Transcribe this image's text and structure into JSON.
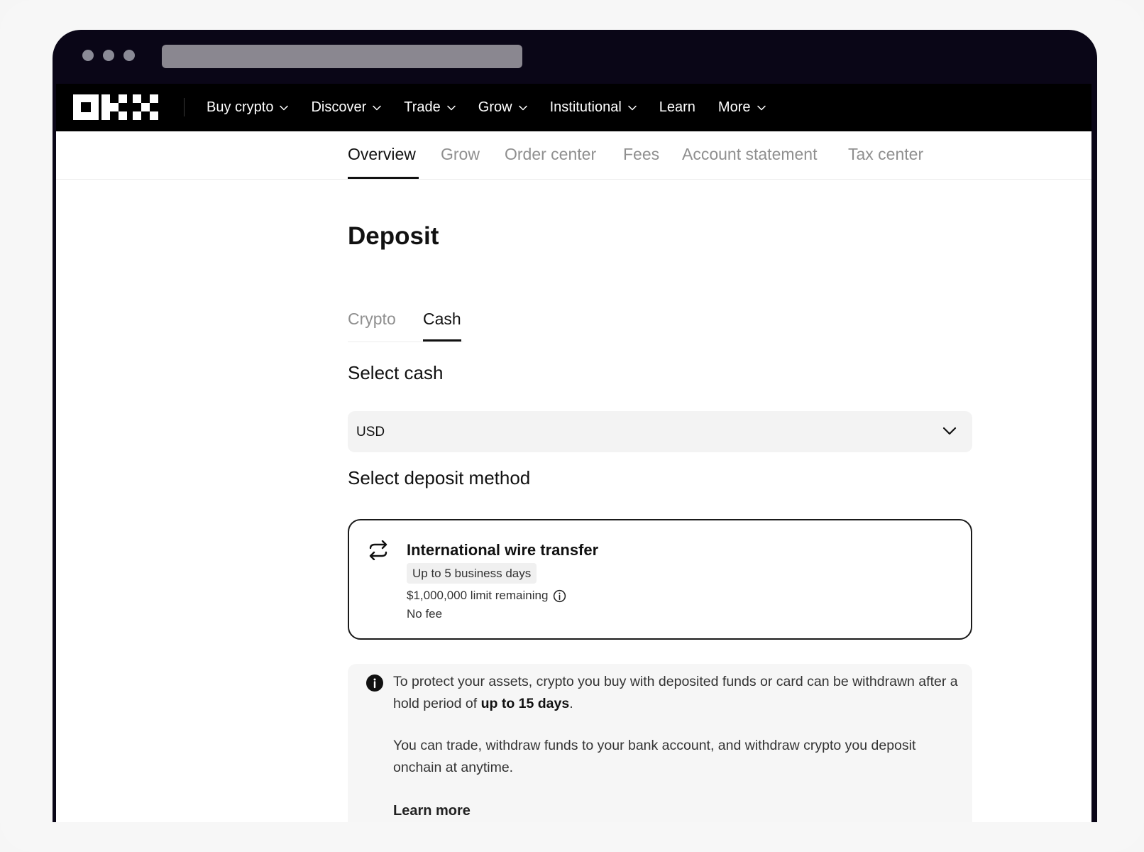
{
  "nav": {
    "items": [
      {
        "label": "Buy crypto",
        "has_dropdown": true
      },
      {
        "label": "Discover",
        "has_dropdown": true
      },
      {
        "label": "Trade",
        "has_dropdown": true
      },
      {
        "label": "Grow",
        "has_dropdown": true
      },
      {
        "label": "Institutional",
        "has_dropdown": true
      },
      {
        "label": "Learn",
        "has_dropdown": false
      },
      {
        "label": "More",
        "has_dropdown": true
      }
    ]
  },
  "subnav": {
    "tabs": [
      "Overview",
      "Grow",
      "Order center",
      "Fees",
      "Account statement",
      "Tax center"
    ],
    "active": "Overview"
  },
  "page": {
    "title": "Deposit",
    "tabs": [
      "Crypto",
      "Cash"
    ],
    "active_tab": "Cash"
  },
  "select_cash": {
    "label": "Select cash",
    "value": "USD"
  },
  "deposit_method": {
    "label": "Select deposit method",
    "title": "International wire transfer",
    "badge": "Up to 5 business days",
    "limit": "$1,000,000 limit remaining",
    "fee": "No fee"
  },
  "notice": {
    "para1_before": "To protect your assets, crypto you buy with deposited funds or card can be withdrawn after a hold period of ",
    "para1_bold": "up to 15 days",
    "para1_after": ".",
    "para2": "You can trade, withdraw funds to your bank account, and withdraw crypto you deposit onchain at anytime.",
    "learn_more": "Learn more"
  },
  "colors": {
    "window_bg": "#0a0617",
    "nav_bg": "#000000",
    "accent": "#111111",
    "muted_text": "#8f8f8f"
  }
}
